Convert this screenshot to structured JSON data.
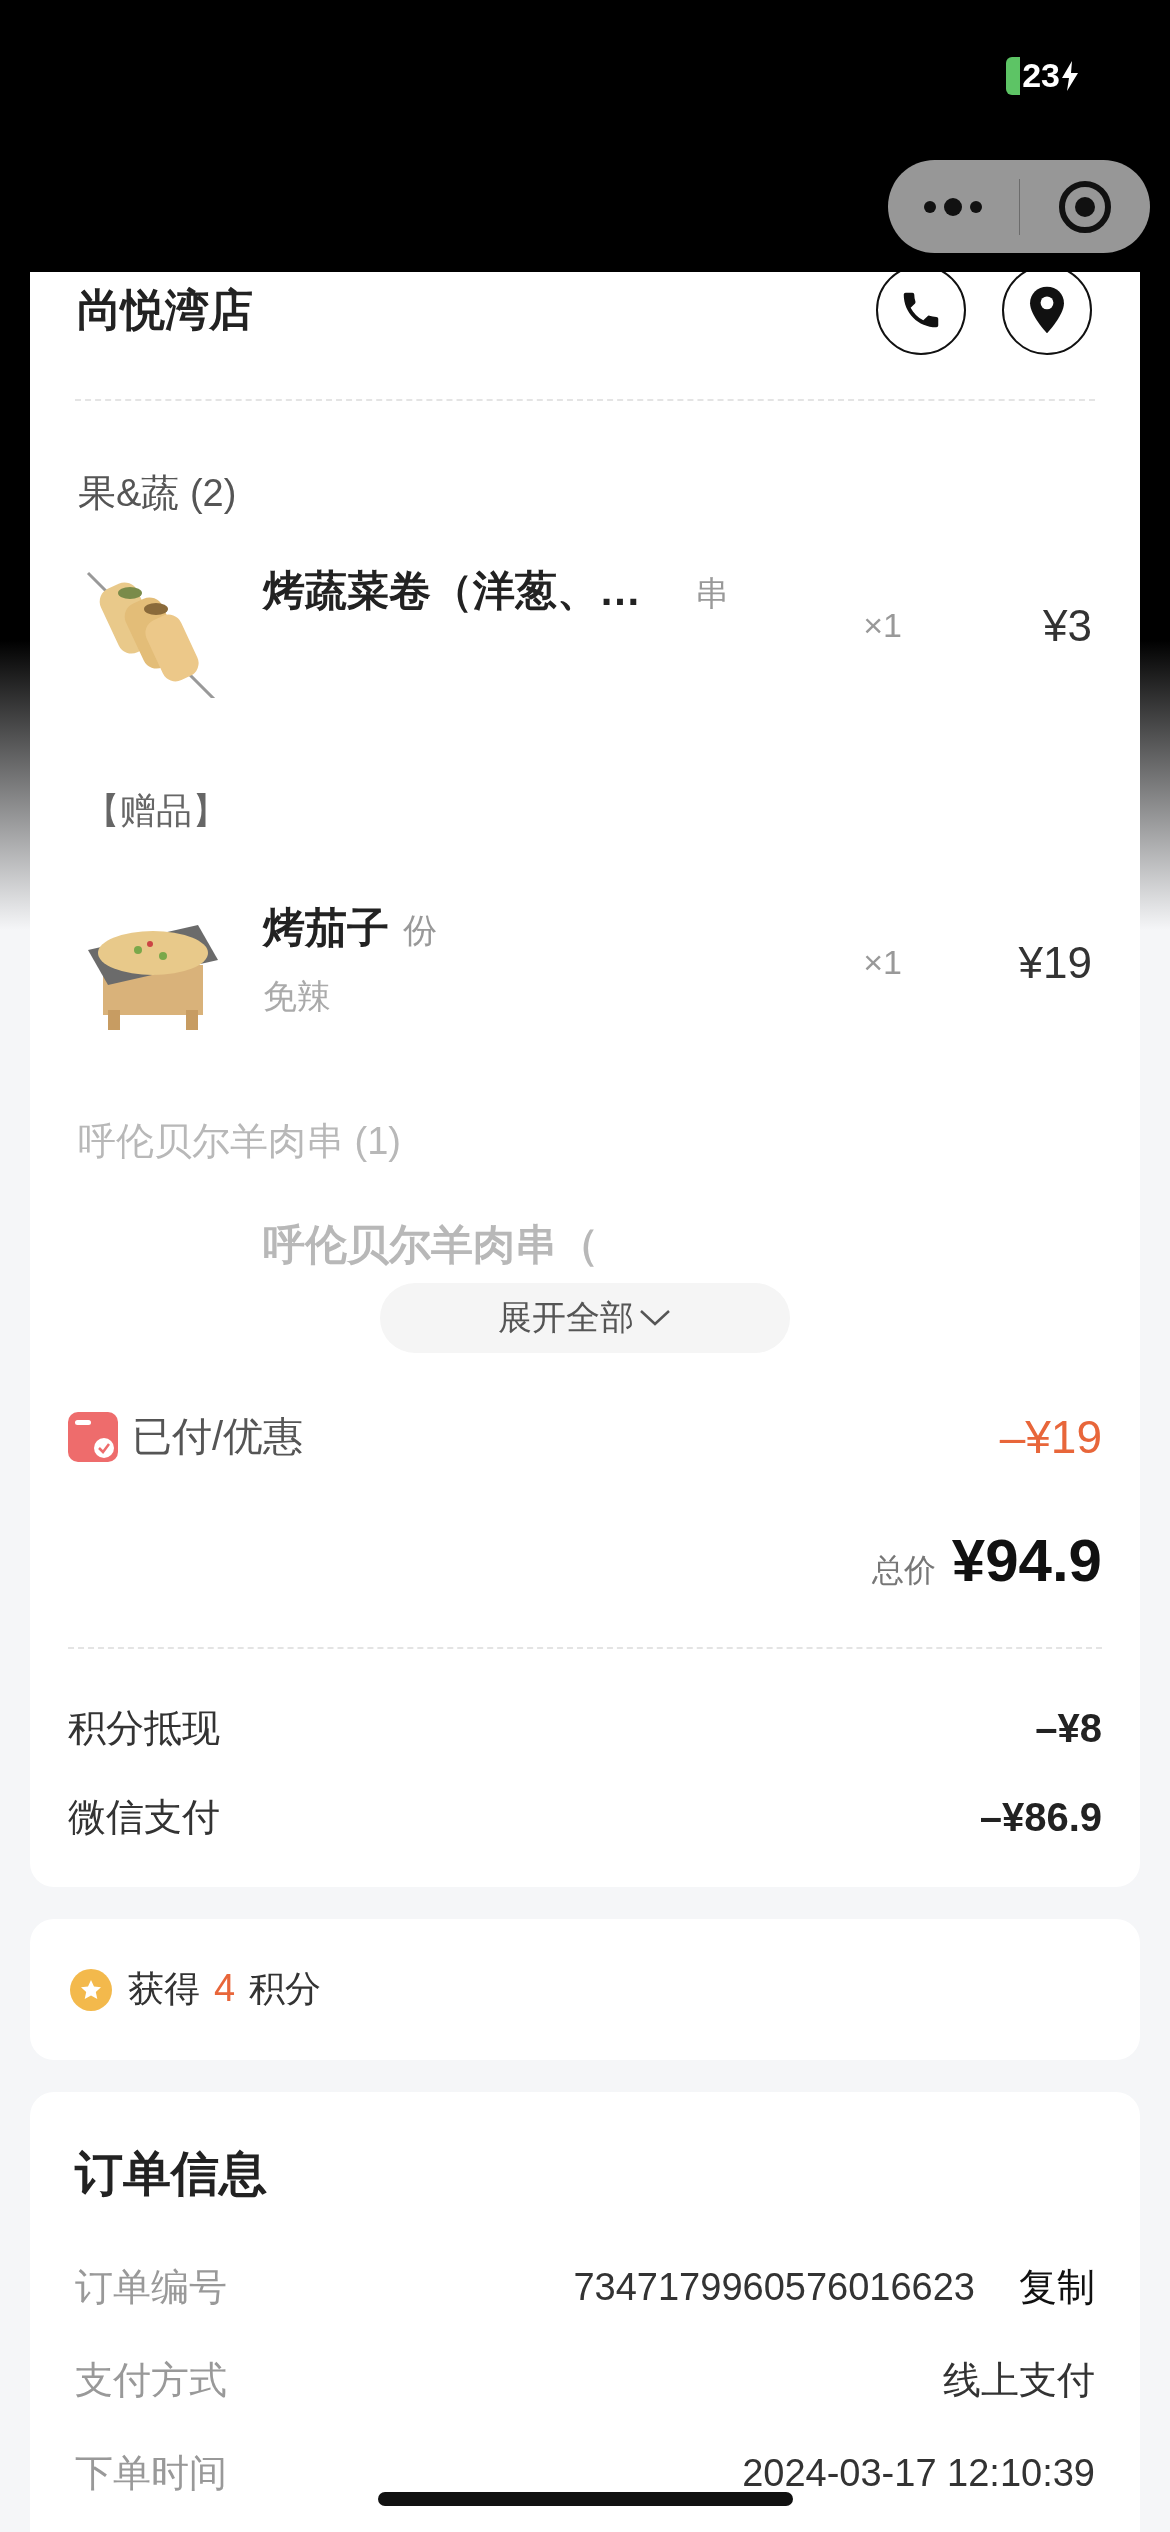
{
  "status_bar": {
    "battery": "23",
    "charging": true
  },
  "store": {
    "name": "尚悦湾店"
  },
  "groups": [
    {
      "title": "果&蔬 (2)",
      "faded": false,
      "items": [
        {
          "name": "烤蔬菜卷（洋葱、…",
          "unit": "串",
          "quantity": "×1",
          "price": "¥3"
        },
        {
          "badge": "【赠品】",
          "name": "烤茄子",
          "unit": "份",
          "note": "免辣",
          "quantity": "×1",
          "price": "¥19"
        }
      ]
    },
    {
      "title": "呼伦贝尔羊肉串 (1)",
      "faded": true,
      "items": [
        {
          "name": "呼伦贝尔羊肉串（"
        }
      ]
    }
  ],
  "expand_button": "展开全部",
  "paid": {
    "label": "已付/优惠",
    "amount": "–¥19"
  },
  "total": {
    "label": "总价",
    "amount": "¥94.9"
  },
  "payments": [
    {
      "label": "积分抵现",
      "amount": "–¥8"
    },
    {
      "label": "微信支付",
      "amount": "–¥86.9"
    }
  ],
  "points": {
    "prefix": "获得",
    "value": "4",
    "suffix": "积分"
  },
  "order_info": {
    "title": "订单信息",
    "rows": [
      {
        "label": "订单编号",
        "value": "7347179960576016623",
        "action": "复制"
      },
      {
        "label": "支付方式",
        "value": "线上支付"
      },
      {
        "label": "下单时间",
        "value": "2024-03-17 12:10:39"
      }
    ]
  }
}
